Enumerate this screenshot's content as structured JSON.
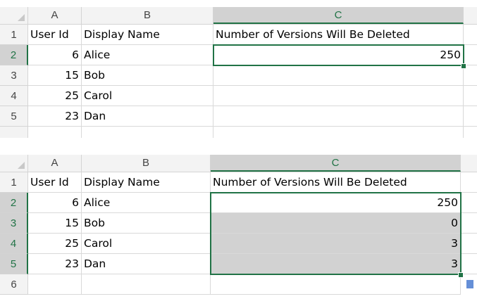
{
  "sheets": [
    {
      "columns": [
        "A",
        "B",
        "C"
      ],
      "rows": [
        {
          "num": "1",
          "a": "User Id",
          "b": "Display Name",
          "c": "Number of Versions Will Be Deleted"
        },
        {
          "num": "2",
          "a": "6",
          "b": "Alice",
          "c": "250"
        },
        {
          "num": "3",
          "a": "15",
          "b": "Bob",
          "c": ""
        },
        {
          "num": "4",
          "a": "25",
          "b": "Carol",
          "c": ""
        },
        {
          "num": "5",
          "a": "23",
          "b": "Dan",
          "c": ""
        }
      ],
      "selection": "C2"
    },
    {
      "columns": [
        "A",
        "B",
        "C"
      ],
      "rows": [
        {
          "num": "1",
          "a": "User Id",
          "b": "Display Name",
          "c": "Number of Versions Will Be Deleted"
        },
        {
          "num": "2",
          "a": "6",
          "b": "Alice",
          "c": "250"
        },
        {
          "num": "3",
          "a": "15",
          "b": "Bob",
          "c": "0"
        },
        {
          "num": "4",
          "a": "25",
          "b": "Carol",
          "c": "3"
        },
        {
          "num": "5",
          "a": "23",
          "b": "Dan",
          "c": "3"
        },
        {
          "num": "6",
          "a": "",
          "b": "",
          "c": ""
        }
      ],
      "selection": "C2:C5"
    }
  ],
  "colors": {
    "accent": "#217346",
    "selection_fill": "#d2d2d2"
  }
}
